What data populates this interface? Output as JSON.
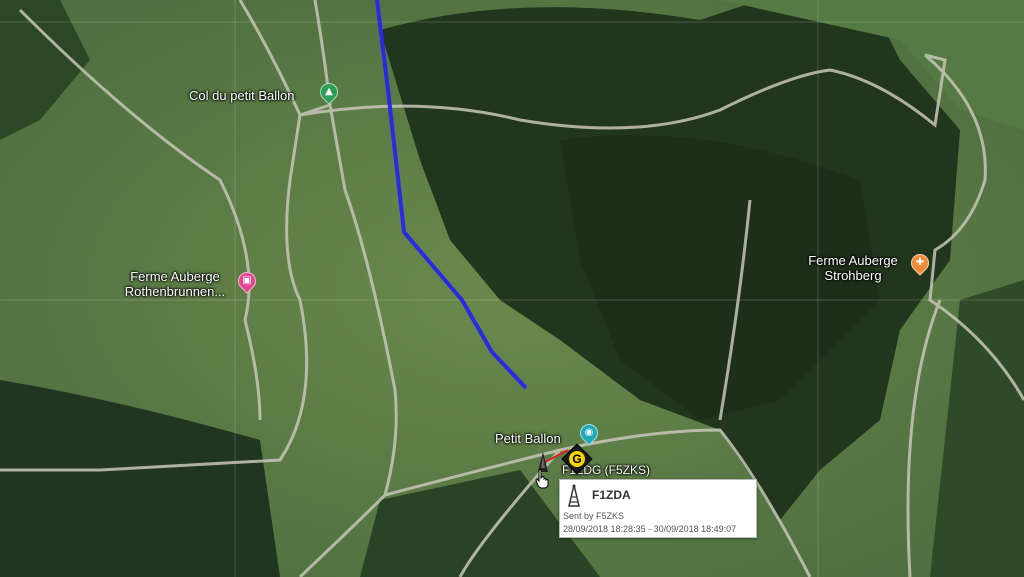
{
  "map": {
    "places": [
      {
        "id": "col",
        "name": "Col du petit Ballon",
        "icon": "tree-icon",
        "color": "#2e9e57"
      },
      {
        "id": "rothenbrunnen",
        "name_line1": "Ferme Auberge",
        "name_line2": "Rothenbrunnen...",
        "icon": "bed-icon",
        "color": "#e64592"
      },
      {
        "id": "strohberg",
        "name_line1": "Ferme Auberge",
        "name_line2": "Strohberg",
        "icon": "fork-knife-icon",
        "color": "#f28a3a"
      },
      {
        "id": "petit_ballon",
        "name": "Petit Ballon",
        "icon": "camera-icon",
        "color": "#1fa8b8"
      }
    ],
    "station_label": "F1ZDG (F5ZKS)",
    "marker_letter": "G",
    "colors": {
      "track": "#2a2ae6",
      "link": "#d22"
    }
  },
  "popup": {
    "title": "F1ZDA",
    "icon": "tower-icon",
    "sent_by": "Sent by F5ZKS",
    "dates": "28/09/2018 18:28:35 - 30/09/2018 18:49:07"
  }
}
